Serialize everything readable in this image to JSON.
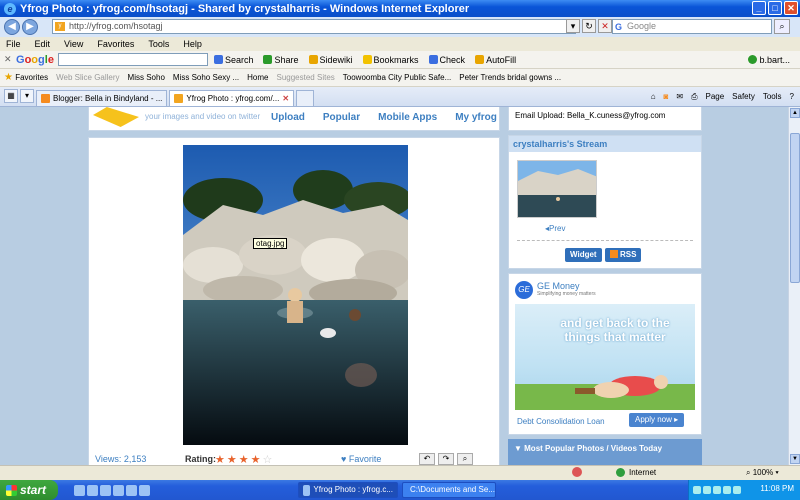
{
  "window": {
    "title": "Yfrog Photo : yfrog.com/hsotagj - Shared by crystalharris - Windows Internet Explorer"
  },
  "address": {
    "url": "http://yfrog.com/hsotagj",
    "search_placeholder": "Google"
  },
  "menubar": [
    "File",
    "Edit",
    "View",
    "Favorites",
    "Tools",
    "Help"
  ],
  "google_toolbar": {
    "brand": "Google",
    "items": [
      "Search",
      "Share",
      "Sidewiki",
      "Bookmarks",
      "Check",
      "AutoFill"
    ],
    "user": "b.bart..."
  },
  "favorites_bar": {
    "label": "Favorites",
    "items": [
      "Web Slice Gallery",
      "Miss Soho",
      "Miss Soho Sexy ...",
      "Home",
      "Suggested Sites",
      "Toowoomba City Public Safe...",
      "Peter Trends bridal gowns ..."
    ]
  },
  "tabs": [
    {
      "label": "Blogger: Bella in Bindyland - ...",
      "active": false
    },
    {
      "label": "Yfrog Photo : yfrog.com/...",
      "active": true
    }
  ],
  "tab_tools": [
    "Page",
    "Safety",
    "Tools"
  ],
  "site": {
    "tagline": "your images and video on twitter",
    "nav": [
      "Upload",
      "Popular",
      "Mobile Apps",
      "My yfrog"
    ],
    "email_upload_label": "Email Upload:",
    "email_upload_address": "Bella_K.cuness@yfrog.com"
  },
  "photo": {
    "tooltip": "otag.jpg",
    "views_label": "Views: 2,153",
    "rating_label": "Rating:",
    "rating_value": 3.5,
    "rating_max": 5,
    "favorite_label": "Favorite"
  },
  "stream": {
    "title": "crystalharris's Stream",
    "prev_label": "Prev",
    "widget_label": "Widget",
    "rss_label": "RSS"
  },
  "ad": {
    "brand": "GE Money",
    "brand_sub": "Simplifying money matters",
    "headline": "and get back to the things that matter",
    "footer": "Debt Consolidation Loan",
    "apply_label": "Apply now"
  },
  "popular": {
    "title": "Most Popular Photos / Videos Today"
  },
  "statusbar": {
    "zone": "Internet",
    "zoom": "100%"
  },
  "taskbar": {
    "start": "start",
    "items": [
      {
        "label": "Yfrog Photo : yfrog.c...",
        "active": true
      },
      {
        "label": "C:\\Documents and Se...",
        "active": false
      }
    ],
    "clock": "11:08 PM"
  }
}
